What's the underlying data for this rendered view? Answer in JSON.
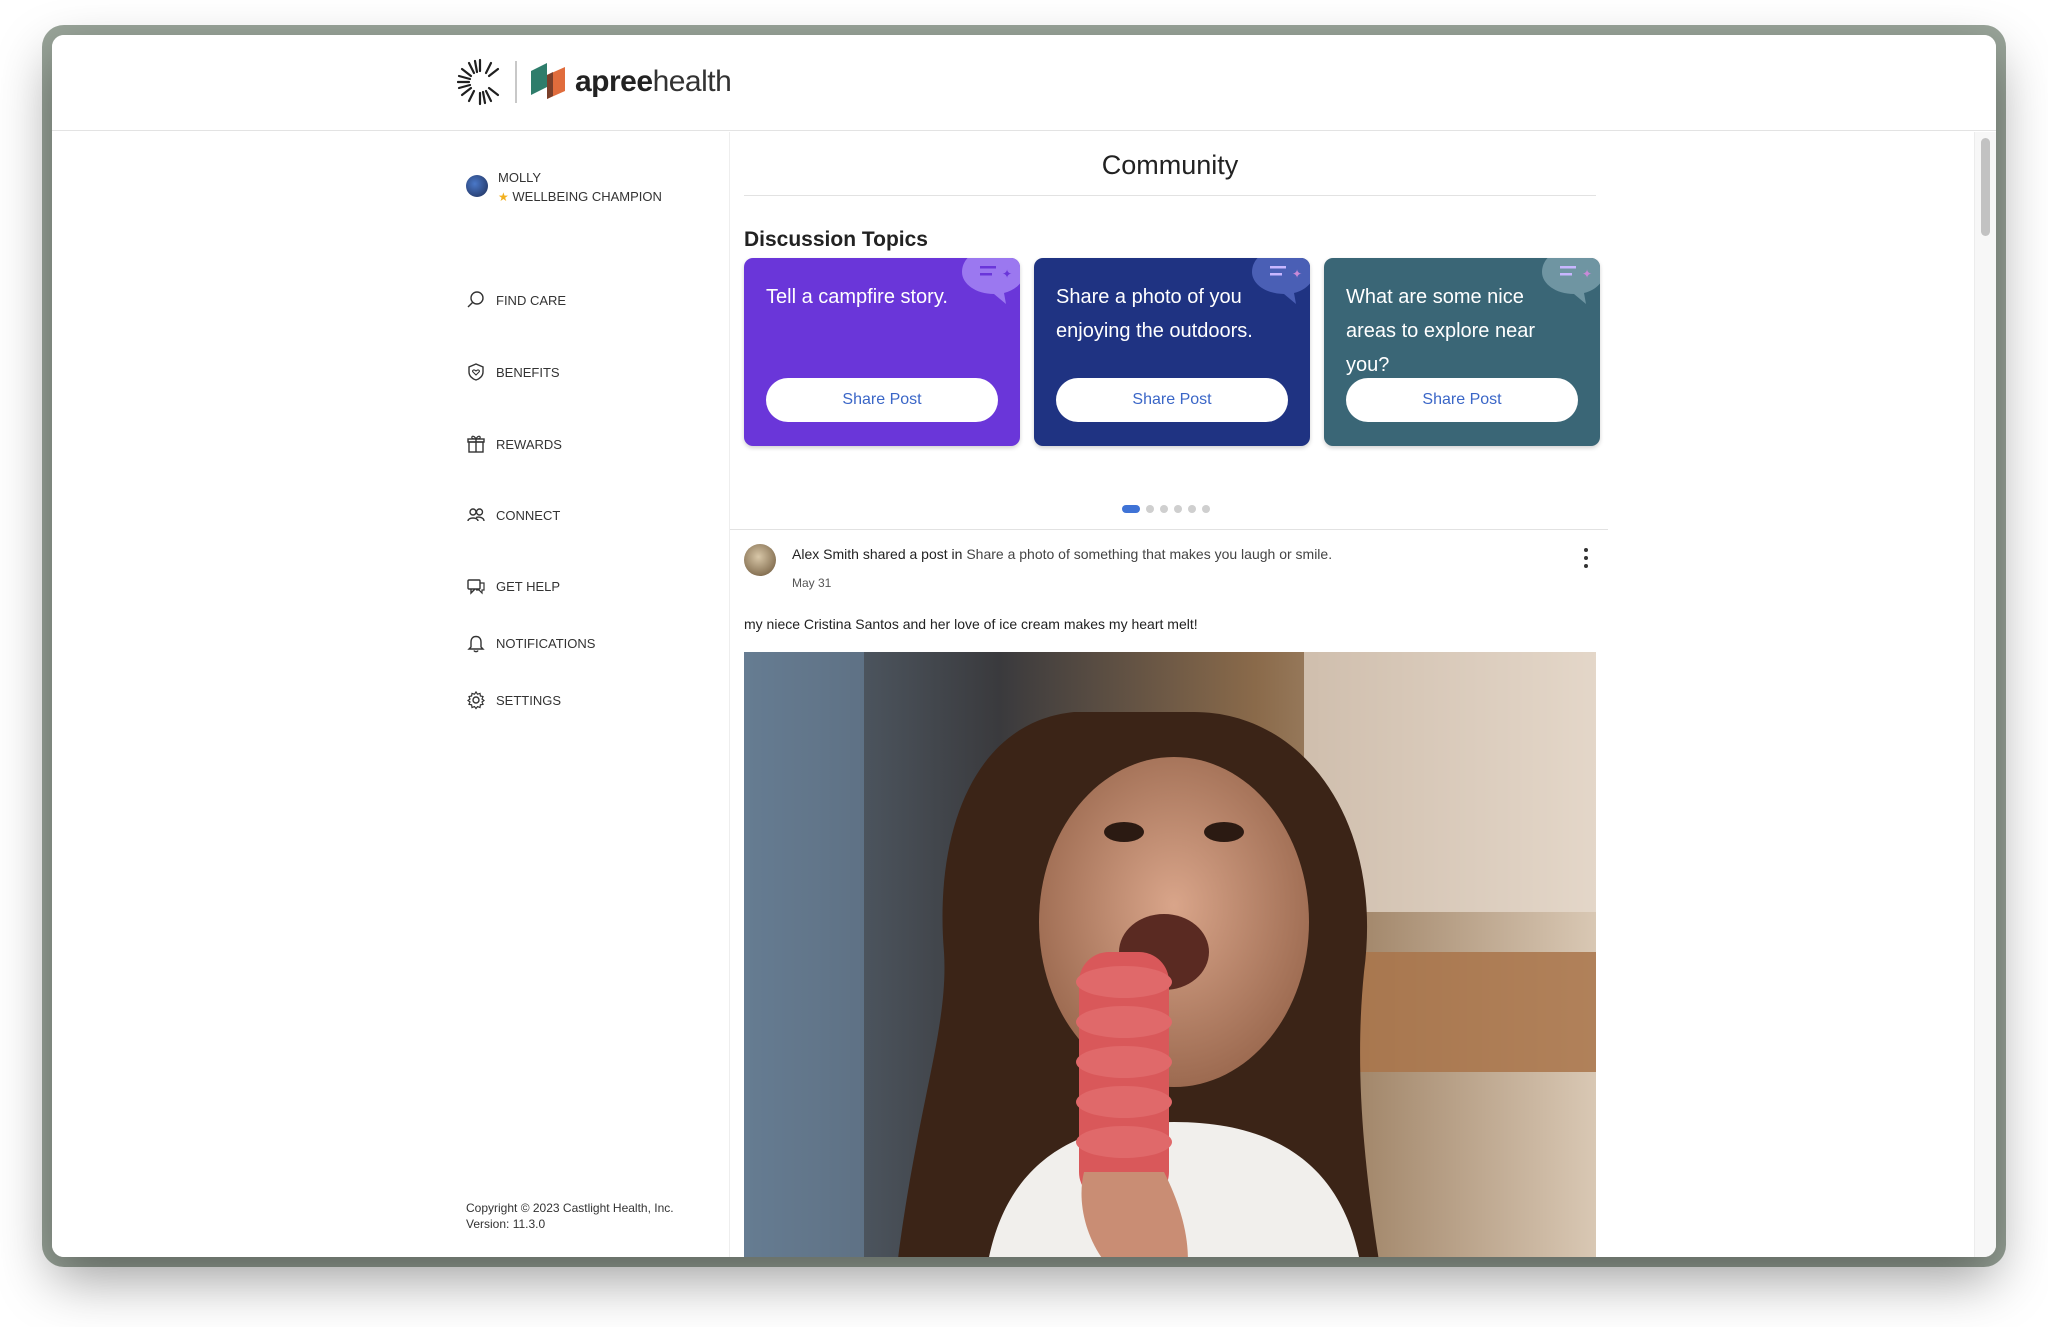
{
  "brand": {
    "name_bold": "apree",
    "name_light": "health"
  },
  "profile": {
    "name": "MOLLY",
    "badge": "WELLBEING CHAMPION",
    "star": "★"
  },
  "nav": {
    "items": [
      {
        "label": "FIND CARE",
        "icon": "search-icon"
      },
      {
        "label": "BENEFITS",
        "icon": "shield-icon"
      },
      {
        "label": "REWARDS",
        "icon": "gift-icon"
      },
      {
        "label": "CONNECT",
        "icon": "people-icon"
      },
      {
        "label": "GET HELP",
        "icon": "chat-help-icon"
      },
      {
        "label": "NOTIFICATIONS",
        "icon": "bell-icon"
      },
      {
        "label": "SETTINGS",
        "icon": "gear-icon"
      }
    ]
  },
  "footer": {
    "copyright": "Copyright © 2023 Castlight Health, Inc.",
    "version": "Version: 11.3.0"
  },
  "page": {
    "title": "Community",
    "section": "Discussion Topics"
  },
  "topics": [
    {
      "prompt": "Tell a campfire story.",
      "button": "Share Post",
      "color": "#6a36d9"
    },
    {
      "prompt": "Share a photo of you enjoying the outdoors.",
      "button": "Share Post",
      "color": "#1f3382"
    },
    {
      "prompt": "What are some nice areas to explore near you?",
      "button": "Share Post",
      "color": "#3a6676"
    }
  ],
  "carousel": {
    "pages": 6,
    "current": 1
  },
  "post": {
    "author": "Alex Smith",
    "action": "shared a post in",
    "topic": "Share a photo of something that makes you laugh or smile.",
    "date": "May 31",
    "text": "my niece Cristina Santos and her love of ice cream makes my heart melt!"
  },
  "colors": {
    "accent": "#3a66c7",
    "dot_active": "#3f73d6"
  }
}
